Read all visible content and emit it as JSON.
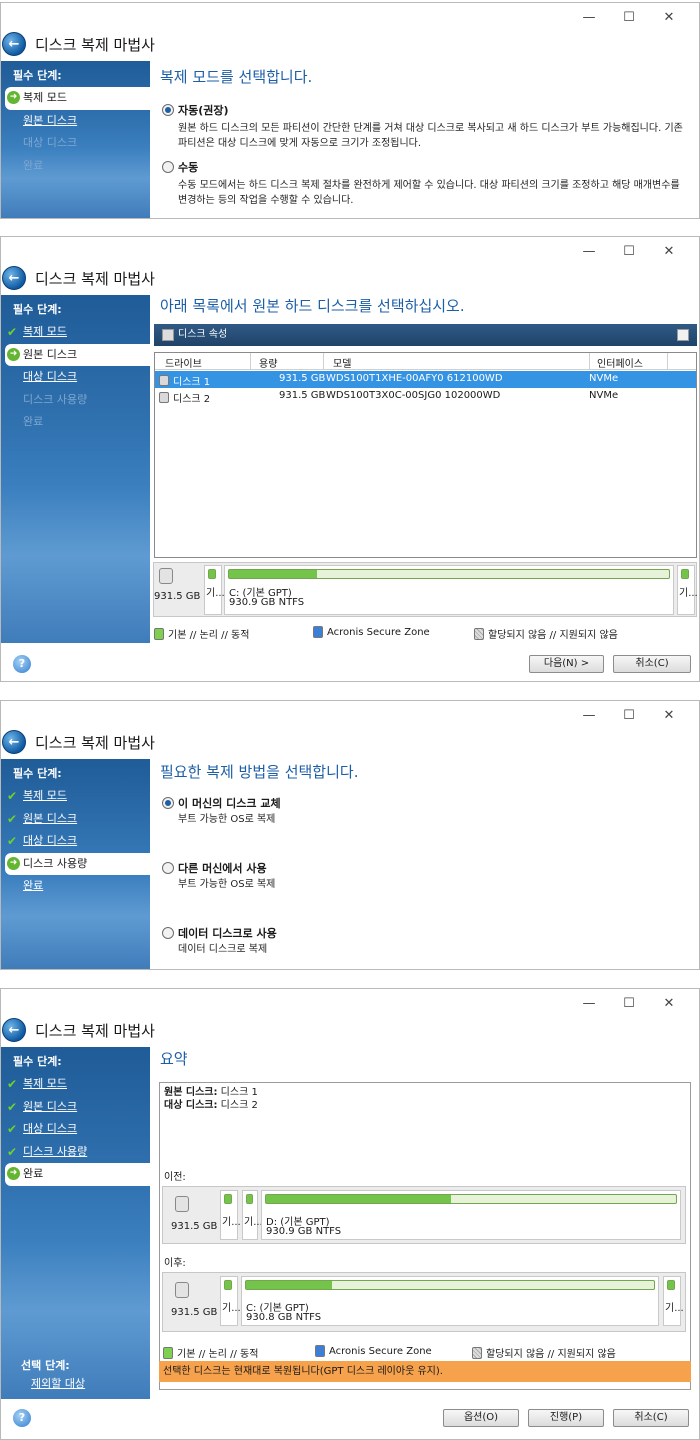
{
  "window": {
    "title": "디스크 복제 마법사",
    "minimize": "—",
    "maximize": "☐",
    "close": "✕"
  },
  "sidebar": {
    "required_header": "필수 단계:",
    "steps": [
      "복제 모드",
      "원본 디스크",
      "대상 디스크",
      "디스크 사용량",
      "완료"
    ],
    "optional_header": "선택 단계:",
    "optional_item": "제외할 대상"
  },
  "step1": {
    "heading": "복제 모드를 선택합니다.",
    "auto_label": "자동(권장)",
    "auto_desc": "원본 하드 디스크의 모든 파티션이 간단한 단계를 거쳐 대상 디스크로 복사되고 새 하드 디스크가 부트 가능해집니다. 기존 파티션은 대상 디스크에 맞게 자동으로 크기가 조정됩니다.",
    "manual_label": "수동",
    "manual_desc": "수동 모드에서는 하드 디스크 복제 절차를 완전하게 제어할 수 있습니다. 대상 파티션의 크기를 조정하고 해당 매개변수를 변경하는 등의 작업을 수행할 수 있습니다."
  },
  "step2": {
    "heading": "아래 목록에서 원본 하드 디스크를 선택하십시오.",
    "toolbar_label": "디스크 속성",
    "columns": [
      "드라이브",
      "용량",
      "모델",
      "인터페이스"
    ],
    "rows": [
      {
        "drive": "디스크 1",
        "size": "931.5 GB",
        "model": "WDS100T1XHE-00AFY0 612100WD",
        "iface": "NVMe"
      },
      {
        "drive": "디스크 2",
        "size": "931.5 GB",
        "model": "WDS100T3X0C-00SJG0 102000WD",
        "iface": "NVMe"
      }
    ],
    "disk_size": "931.5 GB",
    "part_short": "기...",
    "part_name": "C: (기본 GPT)",
    "part_size": "930.9 GB  NTFS",
    "used_fraction": 0.2,
    "next_button": "다음(N) >",
    "cancel_button": "취소(C)"
  },
  "legend": {
    "basic": "기본 // 논리 // 동적",
    "asz": "Acronis Secure Zone",
    "unalloc": "할당되지 않음 // 지원되지 않음"
  },
  "step3": {
    "heading": "필요한 복제 방법을 선택합니다.",
    "opt1_label": "이 머신의 디스크 교체",
    "opt1_desc": "부트 가능한 OS로 복제",
    "opt2_label": "다른 머신에서 사용",
    "opt2_desc": "부트 가능한 OS로 복제",
    "opt3_label": "데이터 디스크로 사용",
    "opt3_desc": "데이터 디스크로 복제"
  },
  "step4": {
    "heading": "요약",
    "source_label": "원본 디스크:",
    "source_value": "디스크 1",
    "target_label": "대상 디스크:",
    "target_value": "디스크 2",
    "before_label": "이전:",
    "after_label": "이후:",
    "before_disk_size": "931.5 GB",
    "before_part_name": "D: (기본 GPT)",
    "before_part_size": "930.9 GB  NTFS",
    "before_used_fraction": 0.45,
    "after_disk_size": "931.5 GB",
    "after_part_name": "C: (기본 GPT)",
    "after_part_size": "930.8 GB  NTFS",
    "after_used_fraction": 0.21,
    "warning": "선택한 디스크는 현재대로 복원됩니다(GPT 디스크 레이아웃 유지).",
    "options_button": "옵션(O)",
    "proceed_button": "진행(P)",
    "cancel_button": "취소(C)"
  },
  "help_icon": "?",
  "colors": {
    "accent": "#1d5fa7",
    "sidebar": "#2f70ae",
    "selection": "#3593e3",
    "warning": "#f6a14c",
    "partition": "#74c34b"
  }
}
